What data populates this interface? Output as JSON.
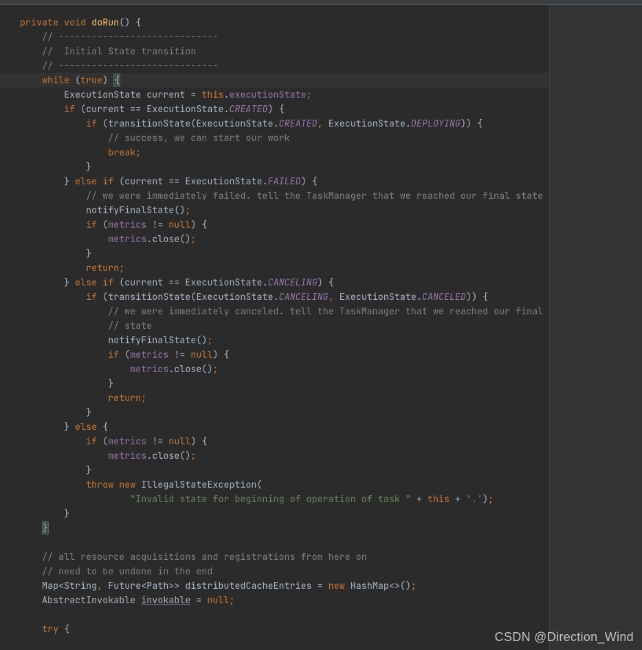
{
  "watermark": "CSDN @Direction_Wind",
  "code": {
    "l1": {
      "kw1": "private",
      "kw2": "void",
      "name": "doRun",
      "after": "() {"
    },
    "l2": "// -----------------------------",
    "l3": "//  Initial State transition",
    "l4": "// -----------------------------",
    "l5": {
      "kw1": "while",
      "p1": " (",
      "kw2": "true",
      "p2": ") ",
      "br": "{"
    },
    "l6": {
      "t1": "ExecutionState current = ",
      "kw": "this",
      "dot": ".",
      "fld": "executionState",
      "semi": ";"
    },
    "l7": {
      "kw": "if",
      "p1": " (current == ExecutionState.",
      "en": "CREATED",
      "p2": ") {"
    },
    "l8": {
      "kw": "if",
      "p1": " (transitionState(ExecutionState.",
      "en1": "CREATED",
      "c": ", ",
      "t2": "ExecutionState.",
      "en2": "DEPLOYING",
      "p2": ")) {"
    },
    "l9": "// success, we can start our work",
    "l10": {
      "kw": "break",
      "semi": ";"
    },
    "l11": "}",
    "l12": {
      "p1": "} ",
      "kw1": "else",
      "sp": " ",
      "kw2": "if",
      "p2": " (current == ExecutionState.",
      "en": "FAILED",
      "p3": ") {"
    },
    "l13": "// we were immediately failed. tell the TaskManager that we reached our final state",
    "l14": {
      "t": "notifyFinalState()",
      "semi": ";"
    },
    "l15": {
      "kw": "if",
      "p1": " (",
      "fld": "metrics",
      "op": " != ",
      "kw2": "null",
      "p2": ") {"
    },
    "l16": {
      "fld": "metrics",
      "dot": ".",
      "m": "close",
      "p": "()",
      "semi": ";"
    },
    "l17": "}",
    "l18": {
      "kw": "return",
      "semi": ";"
    },
    "l19": {
      "p1": "} ",
      "kw1": "else",
      "sp": " ",
      "kw2": "if",
      "p2": " (current == ExecutionState.",
      "en": "CANCELING",
      "p3": ") {"
    },
    "l20": {
      "kw": "if",
      "p1": " (transitionState(ExecutionState.",
      "en1": "CANCELING",
      "c": ", ",
      "t2": "ExecutionState.",
      "en2": "CANCELED",
      "p2": ")) {"
    },
    "l21": "// we were immediately canceled. tell the TaskManager that we reached our final",
    "l22": "// state",
    "l23": {
      "t": "notifyFinalState()",
      "semi": ";"
    },
    "l24": {
      "kw": "if",
      "p1": " (",
      "fld": "metrics",
      "op": " != ",
      "kw2": "null",
      "p2": ") {"
    },
    "l25": {
      "fld": "metrics",
      "dot": ".",
      "m": "close",
      "p": "()",
      "semi": ";"
    },
    "l26": "}",
    "l27": {
      "kw": "return",
      "semi": ";"
    },
    "l28": "}",
    "l29": {
      "p1": "} ",
      "kw": "else",
      "p2": " {"
    },
    "l30": {
      "kw": "if",
      "p1": " (",
      "fld": "metrics",
      "op": " != ",
      "kw2": "null",
      "p2": ") {"
    },
    "l31": {
      "fld": "metrics",
      "dot": ".",
      "m": "close",
      "p": "()",
      "semi": ";"
    },
    "l32": "}",
    "l33": {
      "kw1": "throw",
      "sp": " ",
      "kw2": "new",
      "t": " IllegalStateException("
    },
    "l34": {
      "s": "\"Invalid state for beginning of operation of task \"",
      "op1": " + ",
      "kw": "this",
      "op2": " + ",
      "s2": "'.'",
      "p": ")",
      "semi": ";"
    },
    "l35": "}",
    "l36": "}",
    "l38": "// all resource acquisitions and registrations from here on",
    "l39": "// need to be undone in the end",
    "l40": {
      "t1": "Map<String",
      "c1": ", ",
      "t2": "Future<Path>> distributedCacheEntries = ",
      "kw": "new",
      "t3": " HashMap<>()",
      "semi": ";"
    },
    "l41": {
      "t1": "AbstractInvokable ",
      "u": "invokable",
      "t2": " = ",
      "kw": "null",
      "semi": ";"
    },
    "l43": {
      "kw": "try",
      "p": " {"
    }
  }
}
